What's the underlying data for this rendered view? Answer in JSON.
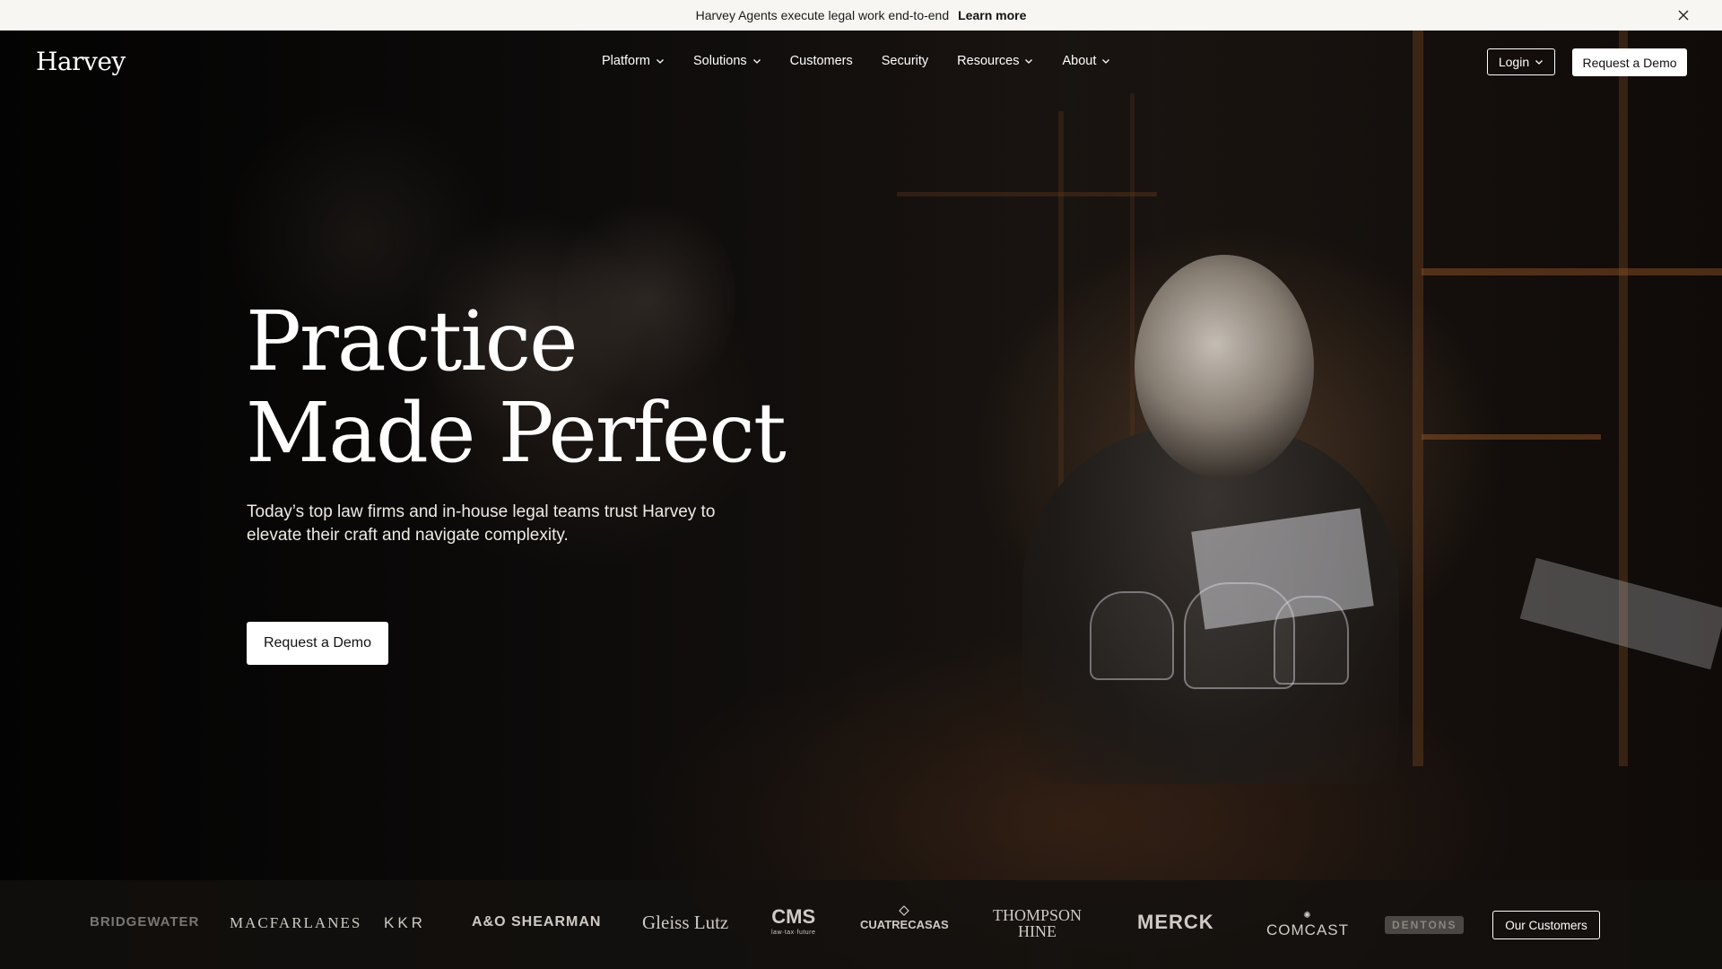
{
  "announcement": {
    "text": "Harvey Agents execute legal work end-to-end",
    "link": "Learn more"
  },
  "nav": {
    "logo": "Harvey",
    "items": [
      {
        "label": "Platform",
        "dropdown": true
      },
      {
        "label": "Solutions",
        "dropdown": true
      },
      {
        "label": "Customers",
        "dropdown": false
      },
      {
        "label": "Security",
        "dropdown": false
      },
      {
        "label": "Resources",
        "dropdown": true
      },
      {
        "label": "About",
        "dropdown": true
      }
    ],
    "login": "Login",
    "request_demo": "Request a Demo"
  },
  "hero": {
    "headline_line1": "Practice",
    "headline_line2": "Made Perfect",
    "subtitle": "Today’s top law firms and in-house legal teams trust Harvey to elevate their craft and navigate complexity.",
    "cta": "Request a Demo"
  },
  "customers": {
    "logos": {
      "bridgewater": "BRIDGEWATER",
      "macfarlanes": "MACFARLANES",
      "kkr": "KKR",
      "ao_shearman": "A&O SHEARMAN",
      "gleiss_lutz": "Gleiss Lutz",
      "cms": "CMS",
      "cms_tagline": "law·tax·future",
      "cuatrecasas": "CUATRECASAS",
      "thompson_hine_1": "THOMPSON",
      "thompson_hine_2": "HINE",
      "merck": "MERCK",
      "comcast": "COMCAST",
      "dentons": "DENTONS"
    },
    "button": "Our Customers"
  },
  "colors": {
    "announce_bg": "#f7f6f3",
    "hero_bg": "#0b0a09",
    "button_bg": "#ffffff",
    "text": "#ffffff"
  }
}
